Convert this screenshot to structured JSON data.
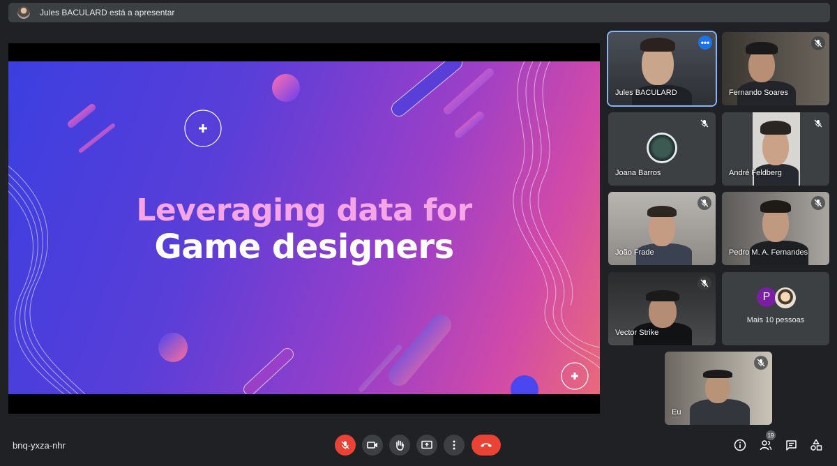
{
  "banner": {
    "presenter_text": "Jules BACULARD está a apresentar"
  },
  "slide": {
    "title_line1": "Leveraging data for",
    "title_line2": "Game designers"
  },
  "participants": [
    {
      "name": "Jules BACULARD",
      "active": true,
      "menu_icon": "more-horiz-icon"
    },
    {
      "name": "Fernando Soares",
      "muted": true
    },
    {
      "name": "Joana Barros",
      "muted": true
    },
    {
      "name": "André Feldberg",
      "muted": true
    },
    {
      "name": "João Frade",
      "muted": true
    },
    {
      "name": "Pedro M. A. Fernandes",
      "muted": true
    },
    {
      "name": "Vector Strike",
      "muted": true
    },
    {
      "name": "Eu",
      "muted": true
    }
  ],
  "more_people": {
    "initial": "P",
    "label": "Mais 10 pessoas"
  },
  "bottom_bar": {
    "meeting_code": "bnq-yxza-nhr",
    "controls": [
      "mic-off-icon",
      "camera-icon",
      "raise-hand-icon",
      "present-screen-icon",
      "more-vert-icon",
      "hang-up-icon"
    ],
    "right_icons": [
      "info-icon",
      "people-icon",
      "chat-icon",
      "activities-icon"
    ],
    "people_count": "19"
  },
  "colors": {
    "background": "#202124",
    "tile": "#3c4043",
    "active_border": "#8ab4f8",
    "danger": "#ea4335",
    "accent": "#1a73e8"
  }
}
